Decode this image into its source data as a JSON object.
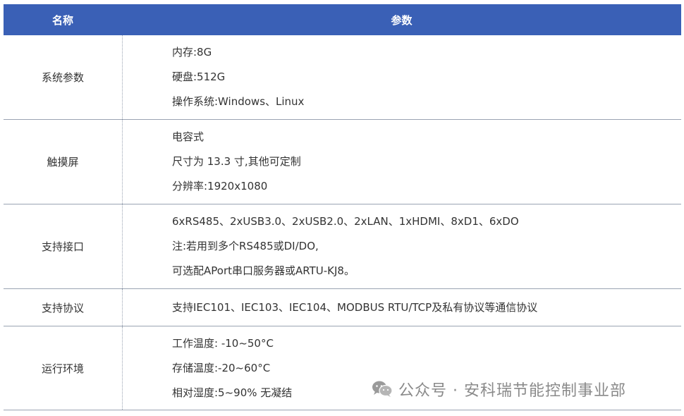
{
  "header": {
    "col_name": "名称",
    "col_params": "参数"
  },
  "rows": [
    {
      "name": "系统参数",
      "params": [
        "内存:8G",
        "硬盘:512G",
        "操作系统:Windows、Linux"
      ]
    },
    {
      "name": "触摸屏",
      "params": [
        "电容式",
        "尺寸为 13.3 寸,其他可定制",
        "分辨率:1920x1080"
      ]
    },
    {
      "name": "支持接口",
      "params": [
        "6xRS485、2xUSB3.0、2xUSB2.0、2xLAN、1xHDMI、8xD1、6xDO",
        "注:若用到多个RS485或DI/DO,",
        "可选配APort串口服务器或ARTU-KJ8。"
      ]
    },
    {
      "name": "支持协议",
      "params": [
        "支持IEC101、IEC103、IEC104、MODBUS RTU/TCP及私有协议等通信协议"
      ]
    },
    {
      "name": "运行环境",
      "params": [
        "工作温度: -10~50°C",
        "存储温度:-20~60°C",
        "相对湿度:5~90% 无凝结"
      ]
    }
  ],
  "watermark": {
    "text": "公众号 · 安科瑞节能控制事业部",
    "icon": "wechat-icon"
  }
}
